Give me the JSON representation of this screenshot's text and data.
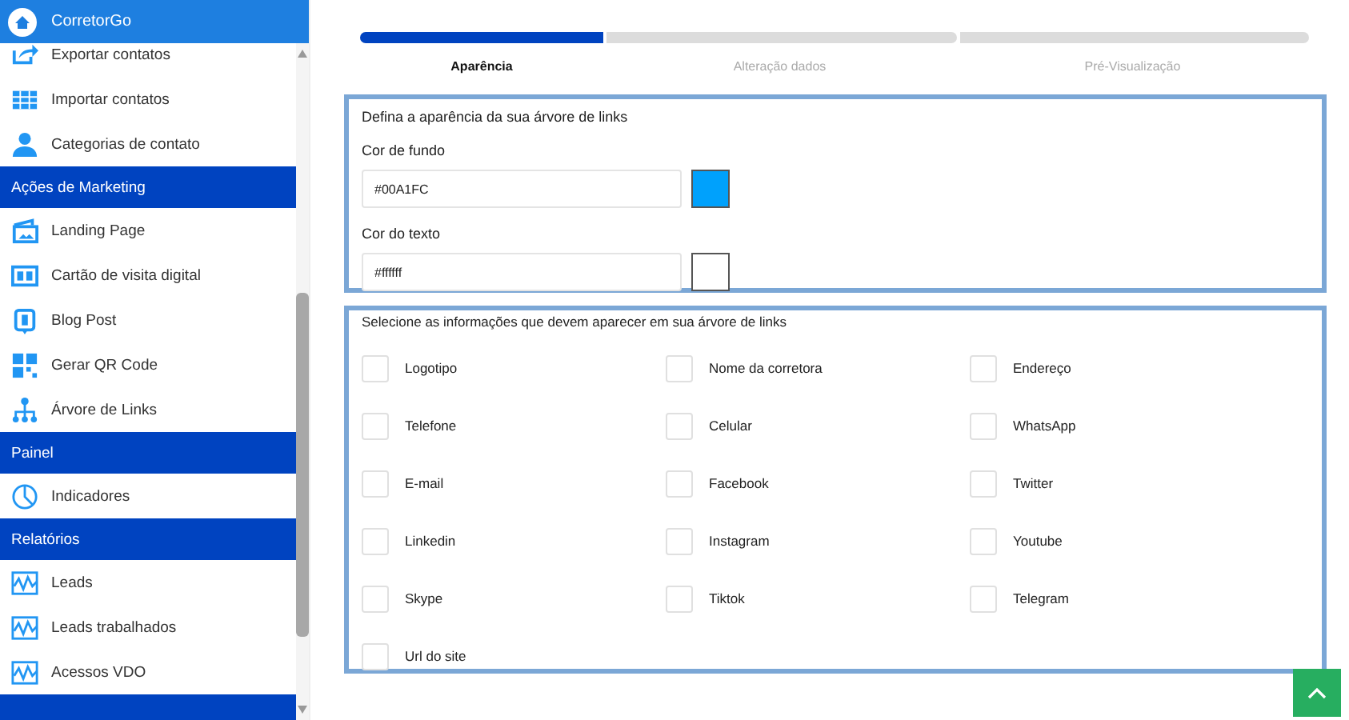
{
  "sidebar": {
    "brand": "CorretorGo",
    "items": [
      {
        "kind": "item",
        "label": "Exportar contatos"
      },
      {
        "kind": "item",
        "label": "Importar contatos"
      },
      {
        "kind": "item",
        "label": "Categorias de contato"
      },
      {
        "kind": "header",
        "label": "Ações de Marketing"
      },
      {
        "kind": "item",
        "label": "Landing Page"
      },
      {
        "kind": "item",
        "label": "Cartão de visita digital"
      },
      {
        "kind": "item",
        "label": "Blog Post"
      },
      {
        "kind": "item",
        "label": "Gerar QR Code"
      },
      {
        "kind": "item",
        "label": "Árvore de Links"
      },
      {
        "kind": "header",
        "label": "Painel"
      },
      {
        "kind": "item",
        "label": "Indicadores"
      },
      {
        "kind": "header",
        "label": "Relatórios"
      },
      {
        "kind": "item",
        "label": "Leads"
      },
      {
        "kind": "item",
        "label": "Leads trabalhados"
      },
      {
        "kind": "item",
        "label": "Acessos VDO"
      },
      {
        "kind": "header"
      }
    ]
  },
  "steps": [
    {
      "label": "Aparência",
      "selected": true
    },
    {
      "label": "Alteração dados",
      "selected": false
    },
    {
      "label": "Pré-Visualização",
      "selected": false
    }
  ],
  "appearance": {
    "title": "Defina a aparência da sua árvore de links",
    "fields": [
      {
        "label": "Cor de fundo",
        "value": "#00A1FC",
        "color": "#00a1fc"
      },
      {
        "label": "Cor do texto",
        "value": "#ffffff",
        "color": "#ffffff"
      }
    ]
  },
  "info": {
    "title": "Selecione as informações que devem aparecer em sua árvore de links",
    "options": [
      {
        "label": "Logotipo",
        "checked": false
      },
      {
        "label": "Nome da corretora",
        "checked": false
      },
      {
        "label": "Endereço",
        "checked": false
      },
      {
        "label": "Telefone",
        "checked": false
      },
      {
        "label": "Celular",
        "checked": false
      },
      {
        "label": "WhatsApp",
        "checked": false
      },
      {
        "label": "E-mail",
        "checked": false
      },
      {
        "label": "Facebook",
        "checked": false
      },
      {
        "label": "Twitter",
        "checked": false
      },
      {
        "label": "Linkedin",
        "checked": false
      },
      {
        "label": "Instagram",
        "checked": false
      },
      {
        "label": "Youtube",
        "checked": false
      },
      {
        "label": "Skype",
        "checked": false
      },
      {
        "label": "Tiktok",
        "checked": false
      },
      {
        "label": "Telegram",
        "checked": false
      },
      {
        "label": "Url do site",
        "checked": false
      }
    ]
  }
}
